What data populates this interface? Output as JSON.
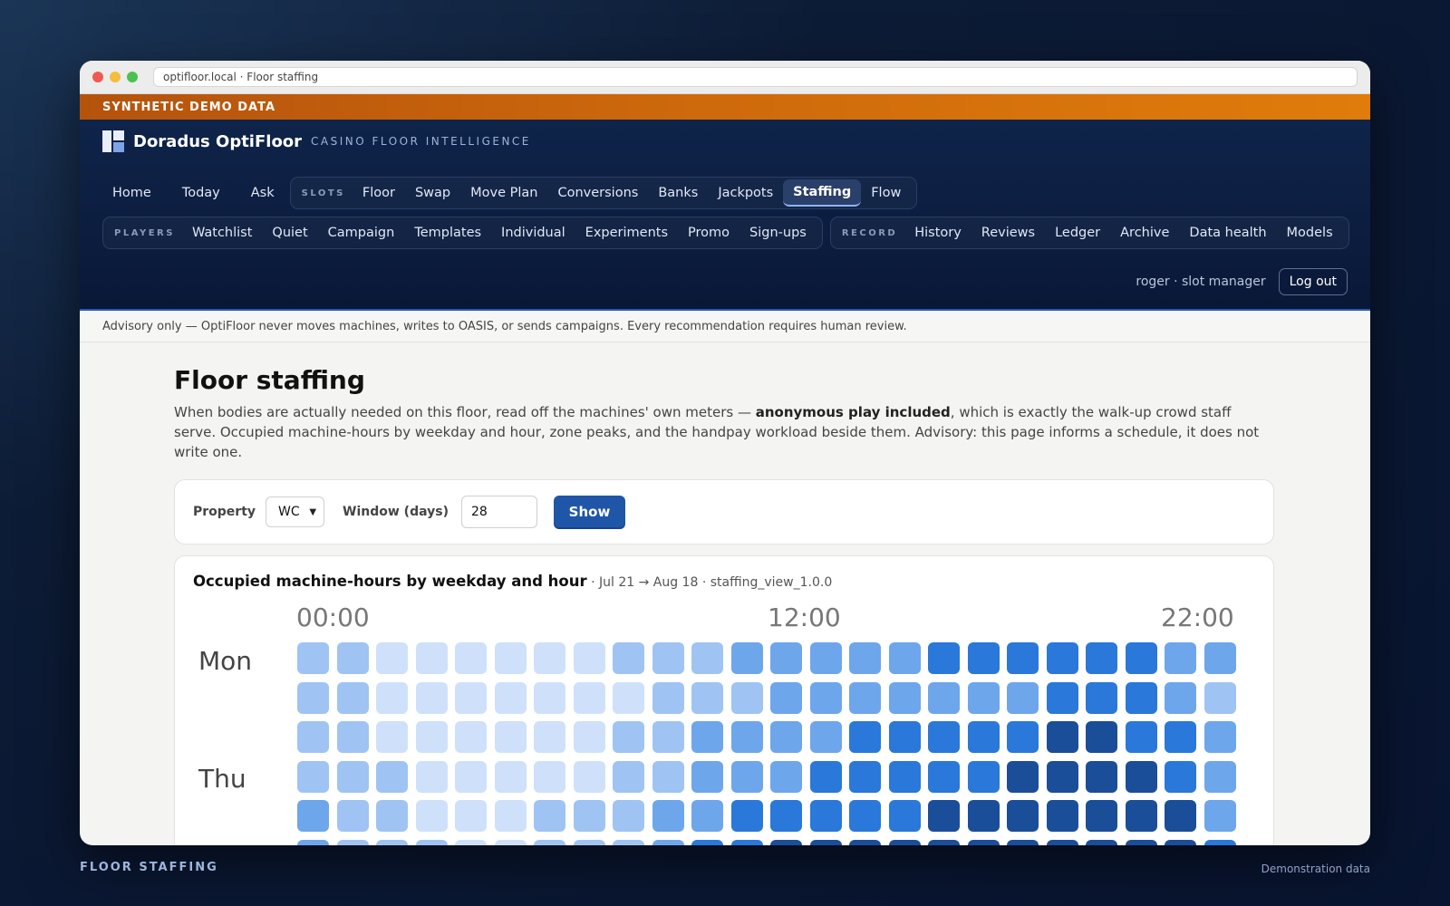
{
  "browser": {
    "url": "optifloor.local · Floor staffing"
  },
  "banner": "SYNTHETIC DEMO DATA",
  "brand": {
    "name": "Doradus OptiFloor",
    "tagline": "CASINO FLOOR INTELLIGENCE"
  },
  "nav": {
    "primary": [
      "Home",
      "Today",
      "Ask"
    ],
    "slots": {
      "label": "SLOTS",
      "items": [
        "Floor",
        "Swap",
        "Move Plan",
        "Conversions",
        "Banks",
        "Jackpots",
        "Staffing",
        "Flow"
      ],
      "active": "Staffing"
    },
    "players": {
      "label": "PLAYERS",
      "items": [
        "Watchlist",
        "Quiet",
        "Campaign",
        "Templates",
        "Individual",
        "Experiments",
        "Promo",
        "Sign-ups"
      ]
    },
    "record": {
      "label": "RECORD",
      "items": [
        "History",
        "Reviews",
        "Ledger",
        "Archive",
        "Data health",
        "Models"
      ]
    }
  },
  "user": {
    "label": "roger · slot manager",
    "logout": "Log out"
  },
  "advisory": "Advisory only — OptiFloor never moves machines, writes to OASIS, or sends campaigns. Every recommendation requires human review.",
  "page": {
    "title": "Floor staffing",
    "desc_before": "When bodies are actually needed on this floor, read off the machines' own meters — ",
    "desc_bold": "anonymous play included",
    "desc_after": ", which is exactly the walk-up crowd staff serve. Occupied machine-hours by weekday and hour, zone peaks, and the handpay workload beside them. Advisory: this page informs a schedule, it does not write one."
  },
  "form": {
    "property_label": "Property",
    "property_value": "WC",
    "window_label": "Window (days)",
    "window_value": "28",
    "show_button": "Show"
  },
  "heatmap": {
    "title": "Occupied machine-hours by weekday and hour",
    "subtitle": " · Jul 21 → Aug 18 · staffing_view_1.0.0",
    "hour_labels": [
      "00:00",
      "12:00",
      "22:00"
    ],
    "day_labels": [
      "Mon",
      "Thu"
    ]
  },
  "colors": {
    "level_1": "#cfe1fa",
    "level_2": "#9fc4f3",
    "level_3": "#6ea6ec",
    "level_4": "#2a78d9",
    "level_5": "#1a4e99"
  },
  "chart_data": {
    "type": "heatmap",
    "note_scale": "intensity levels 1 (lightest) to 5 (darkest)",
    "rows": [
      "Mon",
      "",
      "",
      "Thu",
      "",
      ""
    ],
    "columns": [
      "00:00",
      "",
      "",
      "",
      "",
      "",
      "",
      "",
      "",
      "",
      "",
      "",
      "12:00",
      "",
      "",
      "",
      "",
      "",
      "",
      "",
      "",
      "",
      "22:00"
    ],
    "values": [
      [
        2,
        2,
        1,
        1,
        1,
        1,
        1,
        1,
        2,
        2,
        2,
        3,
        3,
        3,
        3,
        3,
        4,
        4,
        4,
        4,
        4,
        4,
        3,
        3
      ],
      [
        2,
        2,
        1,
        1,
        1,
        1,
        1,
        1,
        1,
        2,
        2,
        2,
        3,
        3,
        3,
        3,
        3,
        3,
        3,
        4,
        4,
        4,
        3,
        2
      ],
      [
        2,
        2,
        1,
        1,
        1,
        1,
        1,
        1,
        2,
        2,
        3,
        3,
        3,
        3,
        4,
        4,
        4,
        4,
        4,
        5,
        5,
        4,
        4,
        3
      ],
      [
        2,
        2,
        2,
        1,
        1,
        1,
        1,
        1,
        2,
        2,
        3,
        3,
        3,
        4,
        4,
        4,
        4,
        4,
        5,
        5,
        5,
        5,
        4,
        3
      ],
      [
        3,
        2,
        2,
        1,
        1,
        1,
        2,
        2,
        2,
        3,
        3,
        4,
        4,
        4,
        4,
        4,
        5,
        5,
        5,
        5,
        5,
        5,
        5,
        3
      ],
      [
        3,
        2,
        2,
        2,
        1,
        1,
        2,
        2,
        2,
        3,
        4,
        4,
        5,
        5,
        5,
        5,
        5,
        5,
        5,
        5,
        5,
        5,
        5,
        4
      ]
    ]
  },
  "footer": {
    "left": "FLOOR STAFFING",
    "right": "Demonstration data"
  }
}
